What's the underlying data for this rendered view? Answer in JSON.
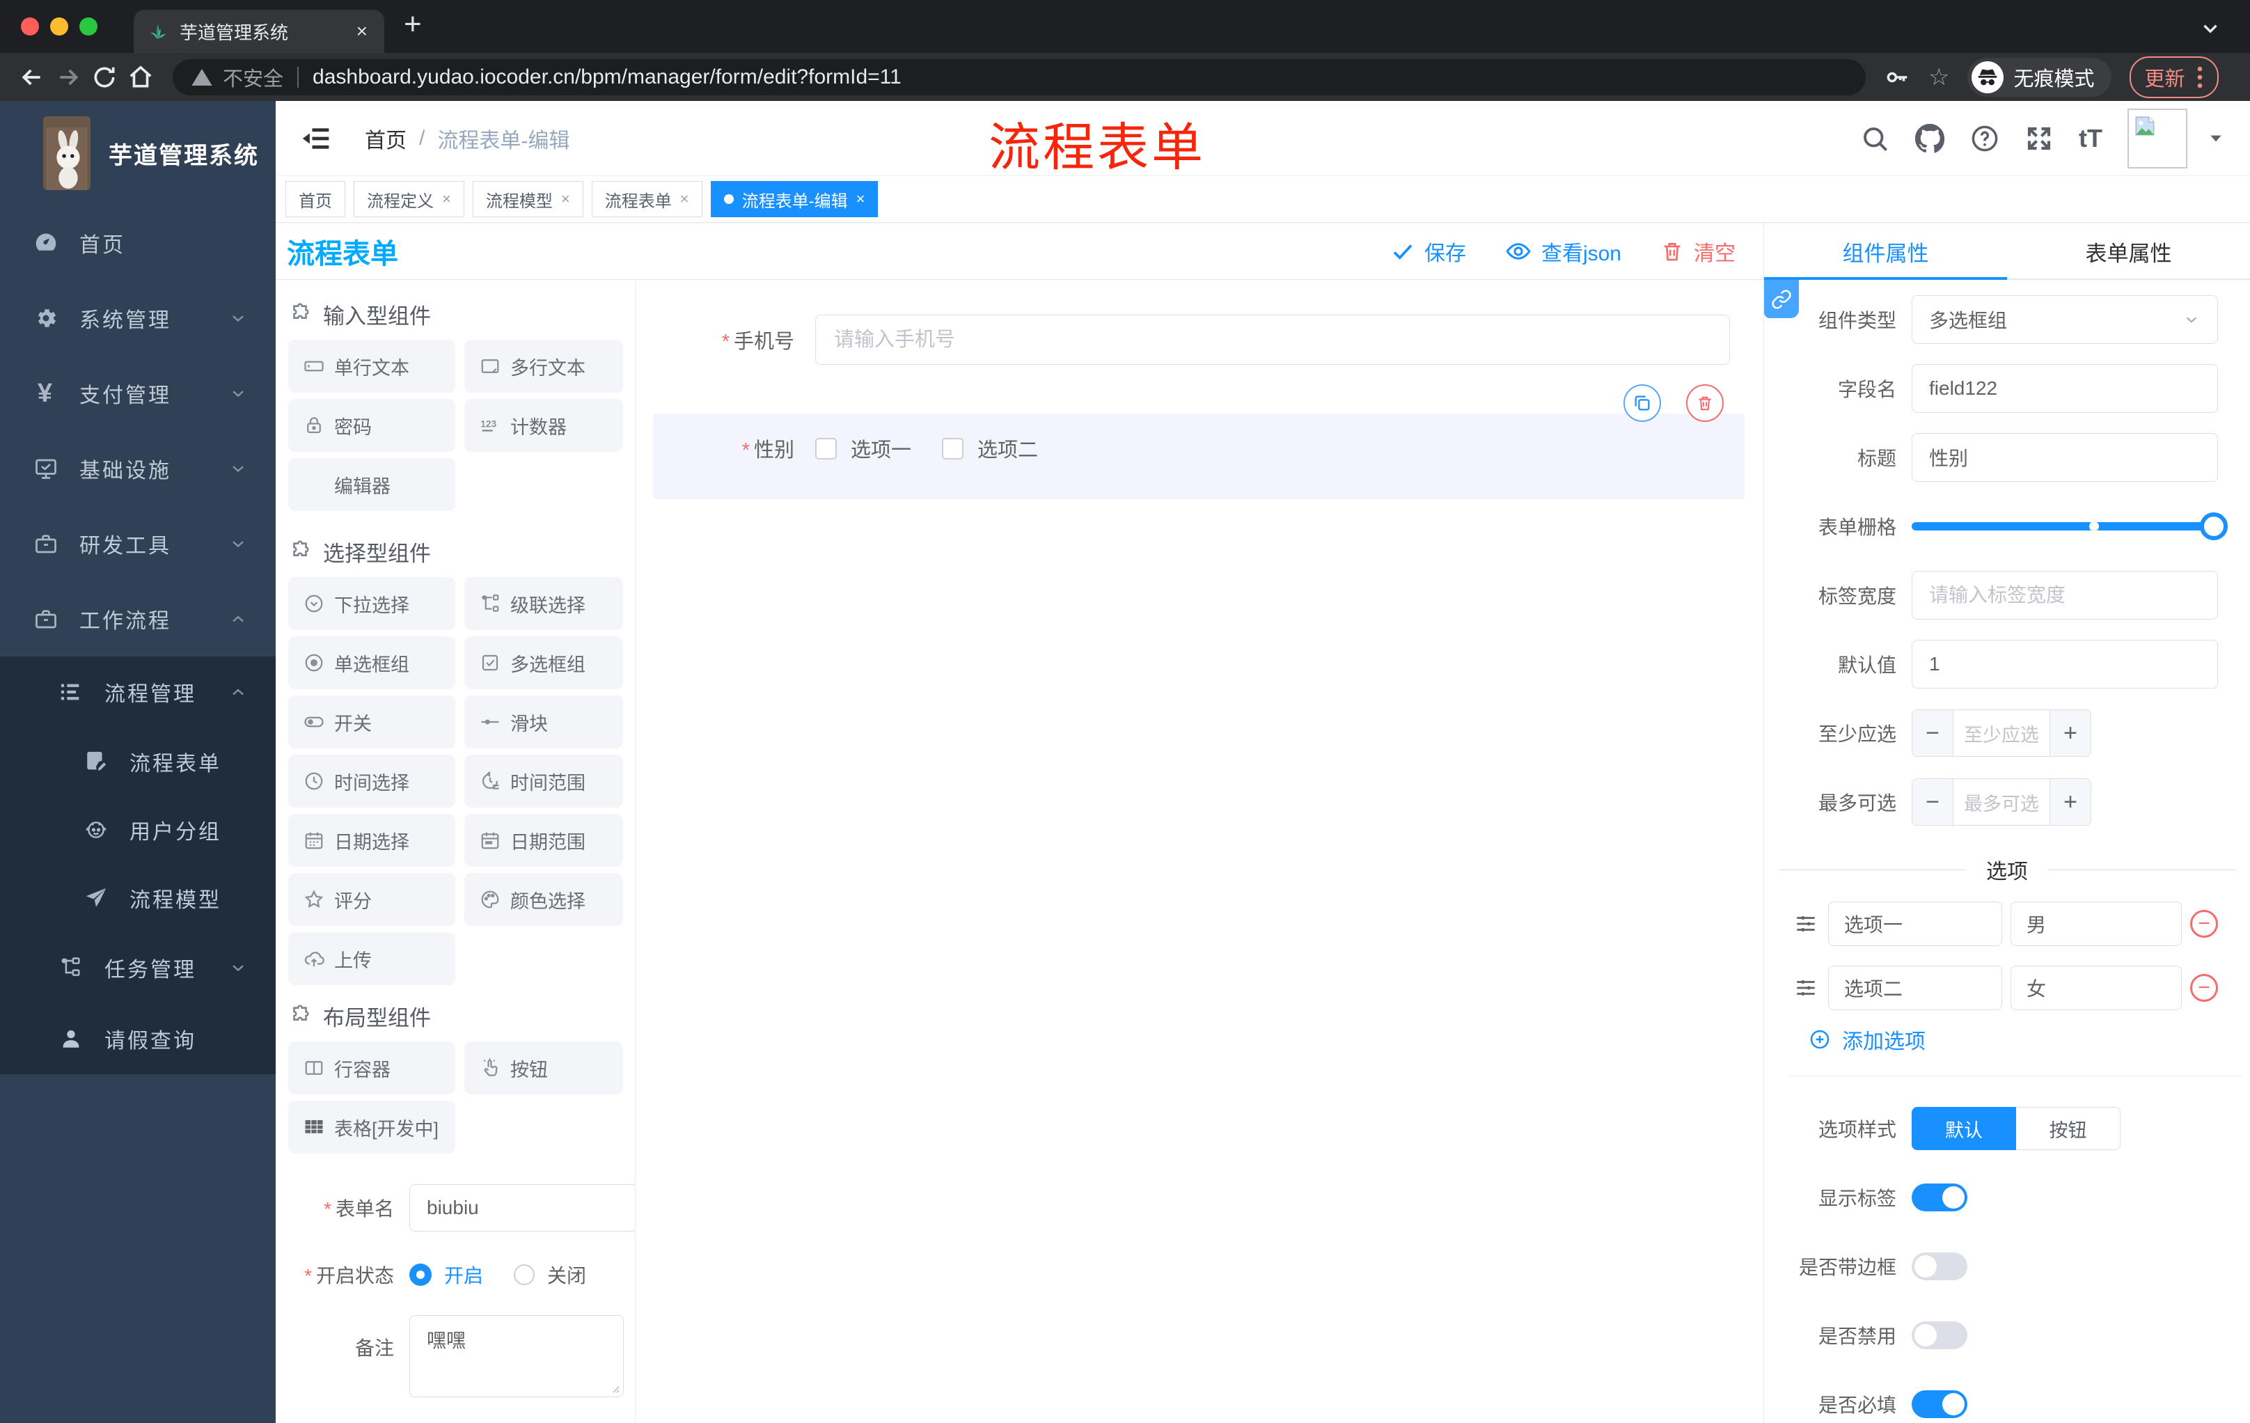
{
  "browser": {
    "tab_title": "芋道管理系统",
    "close": "×",
    "new_tab": "+",
    "security_label": "不安全",
    "url": "dashboard.yudao.iocoder.cn/bpm/manager/form/edit?formId=11",
    "incognito_label": "无痕模式",
    "update_label": "更新"
  },
  "annotation": "流程表单",
  "sidebar": {
    "logo_title": "芋道管理系统",
    "items": [
      {
        "label": "首页"
      },
      {
        "label": "系统管理"
      },
      {
        "label": "支付管理"
      },
      {
        "label": "基础设施"
      },
      {
        "label": "研发工具"
      },
      {
        "label": "工作流程"
      },
      {
        "label": "流程管理"
      },
      {
        "label": "流程表单"
      },
      {
        "label": "用户分组"
      },
      {
        "label": "流程模型"
      },
      {
        "label": "任务管理"
      },
      {
        "label": "请假查询"
      }
    ]
  },
  "navbar": {
    "breadcrumb_home": "首页",
    "breadcrumb_sep": "/",
    "breadcrumb_current": "流程表单-编辑"
  },
  "tags": [
    {
      "label": "首页"
    },
    {
      "label": "流程定义"
    },
    {
      "label": "流程模型"
    },
    {
      "label": "流程表单"
    },
    {
      "label": "流程表单-编辑"
    }
  ],
  "designer": {
    "page_title": "流程表单",
    "toolbar": {
      "save": "保存",
      "view_json": "查看json",
      "clear": "清空"
    },
    "palette": {
      "sections": [
        {
          "title": "输入型组件",
          "items": [
            "单行文本",
            "多行文本",
            "密码",
            "计数器",
            "编辑器"
          ]
        },
        {
          "title": "选择型组件",
          "items": [
            "下拉选择",
            "级联选择",
            "单选框组",
            "多选框组",
            "开关",
            "滑块",
            "时间选择",
            "时间范围",
            "日期选择",
            "日期范围",
            "评分",
            "颜色选择",
            "上传"
          ]
        },
        {
          "title": "布局型组件",
          "items": [
            "行容器",
            "按钮",
            "表格[开发中]"
          ]
        }
      ]
    },
    "form_info": {
      "name_label": "表单名",
      "name_value": "biubiu",
      "status_label": "开启状态",
      "status_on": "开启",
      "status_off": "关闭",
      "remark_label": "备注",
      "remark_value": "嘿嘿"
    },
    "canvas": {
      "phone_label": "手机号",
      "phone_placeholder": "请输入手机号",
      "gender_label": "性别",
      "gender_option1": "选项一",
      "gender_option2": "选项二"
    }
  },
  "inspector": {
    "tab_component": "组件属性",
    "tab_form": "表单属性",
    "component_type_label": "组件类型",
    "component_type_value": "多选框组",
    "field_name_label": "字段名",
    "field_name_value": "field122",
    "title_label": "标题",
    "title_value": "性别",
    "grid_label": "表单栅格",
    "label_width_label": "标签宽度",
    "label_width_placeholder": "请输入标签宽度",
    "default_label": "默认值",
    "default_value": "1",
    "min_label": "至少应选",
    "min_placeholder": "至少应选",
    "max_label": "最多可选",
    "max_placeholder": "最多可选",
    "options_divider": "选项",
    "options": [
      {
        "label": "选项一",
        "value": "男"
      },
      {
        "label": "选项二",
        "value": "女"
      }
    ],
    "add_option": "添加选项",
    "option_style_label": "选项样式",
    "option_style_default": "默认",
    "option_style_button": "按钮",
    "switch_show_label": "显示标签",
    "switch_border": "是否带边框",
    "switch_disabled": "是否禁用",
    "switch_required": "是否必填"
  },
  "ui": {
    "required_mark": "*",
    "minus": "−",
    "plus": "+",
    "font_icon": "tT",
    "question": "?"
  }
}
